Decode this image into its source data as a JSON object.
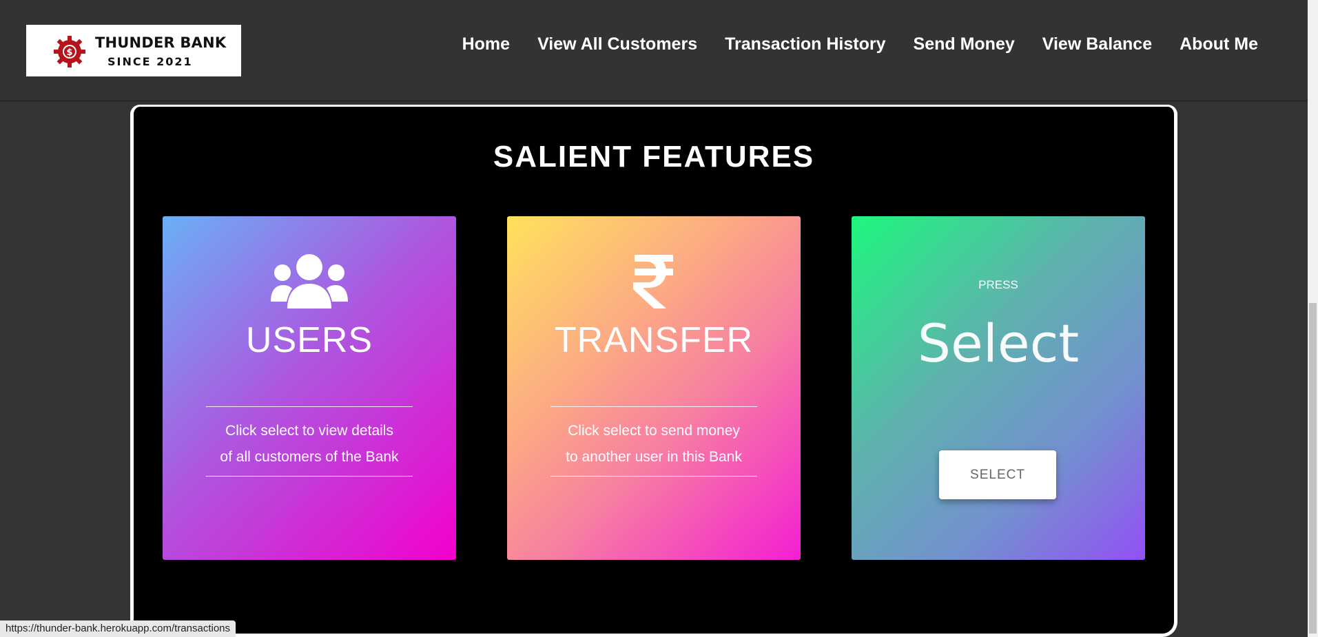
{
  "logo": {
    "name": "THUNDER BANK",
    "since": "SINCE 2021"
  },
  "nav": [
    {
      "label": "Home"
    },
    {
      "label": "View All Customers"
    },
    {
      "label": "Transaction History"
    },
    {
      "label": "Send Money"
    },
    {
      "label": "View Balance"
    },
    {
      "label": "About Me"
    }
  ],
  "features": {
    "title": "SALIENT FEATURES",
    "cards": [
      {
        "icon": "users-icon",
        "title": "USERS",
        "line1": "Click select to view details",
        "line2": "of all customers of the Bank"
      },
      {
        "icon": "rupee-icon",
        "title": "TRANSFER",
        "line1": "Click select to send money",
        "line2": "to another user in this Bank"
      }
    ],
    "select_card": {
      "press": "PRESS",
      "big": "Select",
      "button": "SELECT"
    }
  },
  "status_url": "https://thunder-bank.herokuapp.com/transactions",
  "colors": {
    "navbar": "#333333",
    "background": "#343434",
    "container": "#000000"
  }
}
